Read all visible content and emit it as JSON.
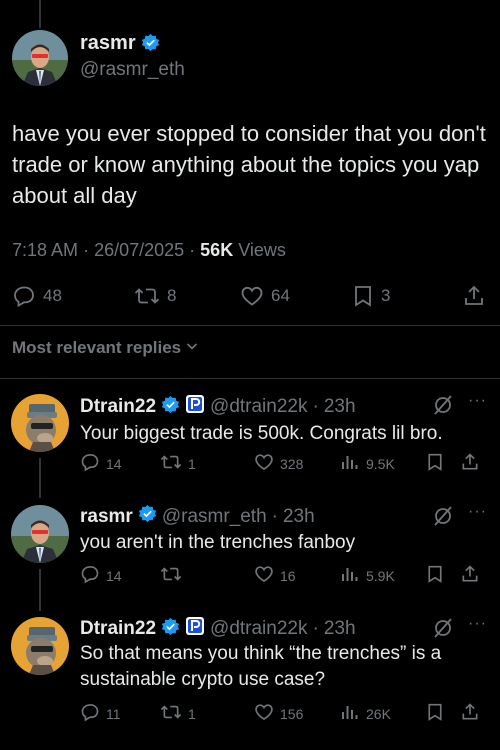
{
  "post": {
    "author_name": "rasmr",
    "author_handle": "@rasmr_eth",
    "text": "have you ever stopped to consider that you don't trade or know anything about the topics you yap about all day",
    "time": "7:18 AM",
    "date": "26/07/2025",
    "views_count": "56K",
    "views_label": "Views",
    "replies": "48",
    "reposts": "8",
    "likes": "64",
    "bookmarks": "3"
  },
  "replies_filter": "Most relevant replies",
  "replies": [
    {
      "name": "Dtrain22",
      "handle": "@dtrain22k",
      "time": "23h",
      "text": "Your biggest trade is 500k. Congrats lil bro.",
      "replies": "14",
      "reposts": "1",
      "likes": "328",
      "views": "9.5K"
    },
    {
      "name": "rasmr",
      "handle": "@rasmr_eth",
      "time": "23h",
      "text": "you aren't in the trenches fanboy",
      "replies": "14",
      "reposts": "",
      "likes": "16",
      "views": "5.9K"
    },
    {
      "name": "Dtrain22",
      "handle": "@dtrain22k",
      "time": "23h",
      "text": "So that means you think “the trenches” is a sustainable crypto use case?",
      "replies": "11",
      "reposts": "1",
      "likes": "156",
      "views": "26K"
    }
  ],
  "icons": {
    "verified": "verified-badge-icon",
    "affiliate": "p-affiliate-badge-icon",
    "reply": "reply-icon",
    "repost": "repost-icon",
    "like": "heart-icon",
    "bookmark": "bookmark-icon",
    "share": "share-icon",
    "views": "views-bar-icon",
    "grok": "grok-icon",
    "more": "more-icon"
  },
  "colors": {
    "background": "#000000",
    "text": "#e7e9ea",
    "muted": "#71767b",
    "verified": "#1d9bf0"
  }
}
